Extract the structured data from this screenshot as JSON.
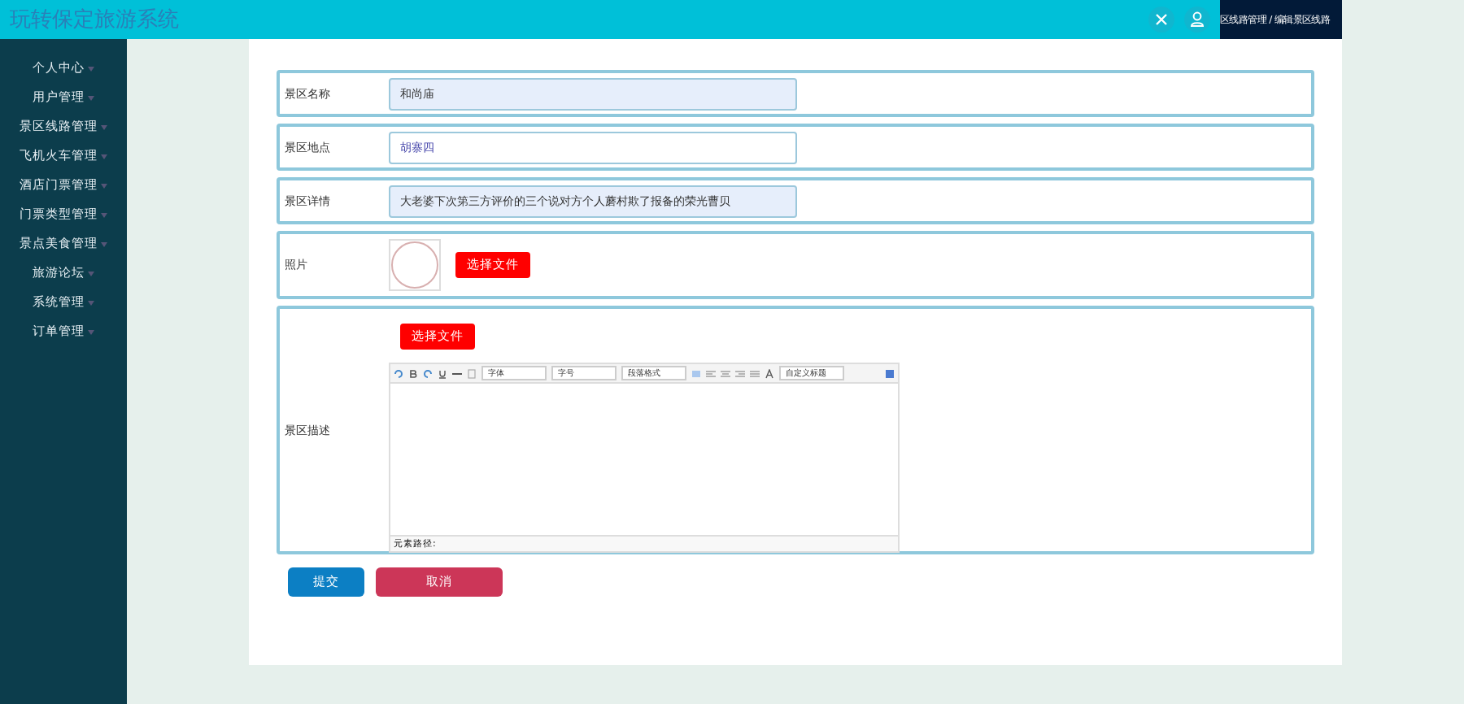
{
  "header": {
    "title": "玩转保定旅游系统",
    "breadcrumb": "区线路管理 / 编辑景区线路"
  },
  "sidebar": {
    "items": [
      {
        "label": "个人中心"
      },
      {
        "label": "用户管理"
      },
      {
        "label": "景区线路管理"
      },
      {
        "label": "飞机火车管理"
      },
      {
        "label": "酒店门票管理"
      },
      {
        "label": "门票类型管理"
      },
      {
        "label": "景点美食管理"
      },
      {
        "label": "旅游论坛"
      },
      {
        "label": "系统管理"
      },
      {
        "label": "订单管理"
      }
    ]
  },
  "form": {
    "fields": [
      {
        "kind": "text",
        "label": "景区名称",
        "value": "和尚庙",
        "highlighted": true
      },
      {
        "kind": "text",
        "label": "景区地点",
        "value": "胡寨四",
        "highlighted": false
      },
      {
        "kind": "text",
        "label": "景区详情",
        "value": "大老婆下次第三方评价的三个说对方个人蘑村欺了报备的荣光曹贝",
        "highlighted": true
      },
      {
        "kind": "image",
        "label": "照片",
        "button": "选择文件"
      },
      {
        "kind": "editor",
        "label": "景区描述",
        "button": "选择文件",
        "toolbar": {
          "font": "字体",
          "size": "字号",
          "paragraph": "段落格式",
          "heading": "自定义标题"
        },
        "footer": "元素路径:"
      }
    ],
    "buttons": [
      {
        "kind": "primary",
        "label": "提交"
      },
      {
        "kind": "danger",
        "label": "取消"
      }
    ]
  }
}
